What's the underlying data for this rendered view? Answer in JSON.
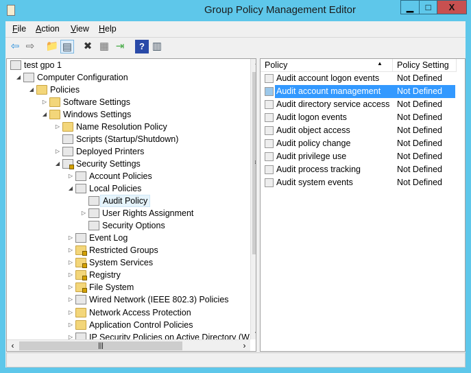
{
  "window": {
    "title": "Group Policy Management Editor",
    "minimize": "▁",
    "maximize": "□",
    "close": "X"
  },
  "menu": [
    {
      "label": "File",
      "key": "F",
      "rest": "ile"
    },
    {
      "label": "Action",
      "key": "A",
      "rest": "ction"
    },
    {
      "label": "View",
      "key": "V",
      "rest": "iew"
    },
    {
      "label": "Help",
      "key": "H",
      "rest": "elp"
    }
  ],
  "toolbar": [
    {
      "icon": "back-arrow-icon",
      "glyph": "⇦"
    },
    {
      "icon": "forward-arrow-icon",
      "glyph": "⇨"
    },
    {
      "icon": "up-folder-icon",
      "glyph": "📁"
    },
    {
      "icon": "show-hide-tree-icon",
      "glyph": "▤"
    },
    {
      "icon": "delete-icon",
      "glyph": "✖"
    },
    {
      "icon": "properties-icon",
      "glyph": "▦"
    },
    {
      "icon": "export-list-icon",
      "glyph": "⇥"
    },
    {
      "icon": "help-icon",
      "glyph": "?"
    },
    {
      "icon": "show-action-pane-icon",
      "glyph": "▥"
    }
  ],
  "tree": [
    {
      "label": "test gpo 1",
      "level": 0,
      "expander": "",
      "icon": "sheet"
    },
    {
      "label": "Computer Configuration",
      "level": 1,
      "expander": "◢",
      "icon": "sheet"
    },
    {
      "label": "Policies",
      "level": 2,
      "expander": "◢",
      "icon": "folder"
    },
    {
      "label": "Software Settings",
      "level": 3,
      "expander": "▷",
      "icon": "folder"
    },
    {
      "label": "Windows Settings",
      "level": 3,
      "expander": "◢",
      "icon": "folder"
    },
    {
      "label": "Name Resolution Policy",
      "level": 4,
      "expander": "▷",
      "icon": "folder"
    },
    {
      "label": "Scripts (Startup/Shutdown)",
      "level": 4,
      "expander": "",
      "icon": "sheet"
    },
    {
      "label": "Deployed Printers",
      "level": 4,
      "expander": "▷",
      "icon": "sheet"
    },
    {
      "label": "Security Settings",
      "level": 4,
      "expander": "◢",
      "icon": "sheetlock"
    },
    {
      "label": "Account Policies",
      "level": 5,
      "expander": "▷",
      "icon": "sheet"
    },
    {
      "label": "Local Policies",
      "level": 5,
      "expander": "◢",
      "icon": "sheet"
    },
    {
      "label": "Audit Policy",
      "level": 6,
      "expander": "",
      "icon": "sheet",
      "selected": true
    },
    {
      "label": "User Rights Assignment",
      "level": 6,
      "expander": "▷",
      "icon": "sheet"
    },
    {
      "label": "Security Options",
      "level": 6,
      "expander": "",
      "icon": "sheet"
    },
    {
      "label": "Event Log",
      "level": 5,
      "expander": "▷",
      "icon": "sheet"
    },
    {
      "label": "Restricted Groups",
      "level": 5,
      "expander": "▷",
      "icon": "folderlock"
    },
    {
      "label": "System Services",
      "level": 5,
      "expander": "▷",
      "icon": "folderlock"
    },
    {
      "label": "Registry",
      "level": 5,
      "expander": "▷",
      "icon": "folderlock"
    },
    {
      "label": "File System",
      "level": 5,
      "expander": "▷",
      "icon": "folderlock"
    },
    {
      "label": "Wired Network (IEEE 802.3) Policies",
      "level": 5,
      "expander": "▷",
      "icon": "sheet"
    },
    {
      "label": "Network Access Protection",
      "level": 5,
      "expander": "▷",
      "icon": "folder"
    },
    {
      "label": "Application Control Policies",
      "level": 5,
      "expander": "▷",
      "icon": "folder"
    },
    {
      "label": "IP Security Policies on Active Directory (W",
      "level": 5,
      "expander": "▷",
      "icon": "sheet"
    }
  ],
  "list": {
    "columns": [
      "Policy",
      "Policy Setting"
    ],
    "sort_indicator": "▲",
    "rows": [
      {
        "policy": "Audit account logon events",
        "setting": "Not Defined"
      },
      {
        "policy": "Audit account management",
        "setting": "Not Defined",
        "selected": true
      },
      {
        "policy": "Audit directory service access",
        "setting": "Not Defined"
      },
      {
        "policy": "Audit logon events",
        "setting": "Not Defined"
      },
      {
        "policy": "Audit object access",
        "setting": "Not Defined"
      },
      {
        "policy": "Audit policy change",
        "setting": "Not Defined"
      },
      {
        "policy": "Audit privilege use",
        "setting": "Not Defined"
      },
      {
        "policy": "Audit process tracking",
        "setting": "Not Defined"
      },
      {
        "policy": "Audit system events",
        "setting": "Not Defined"
      }
    ]
  },
  "colors": {
    "titlebar": "#5ec7ea",
    "close": "#c75050",
    "selection": "#3399ff"
  }
}
